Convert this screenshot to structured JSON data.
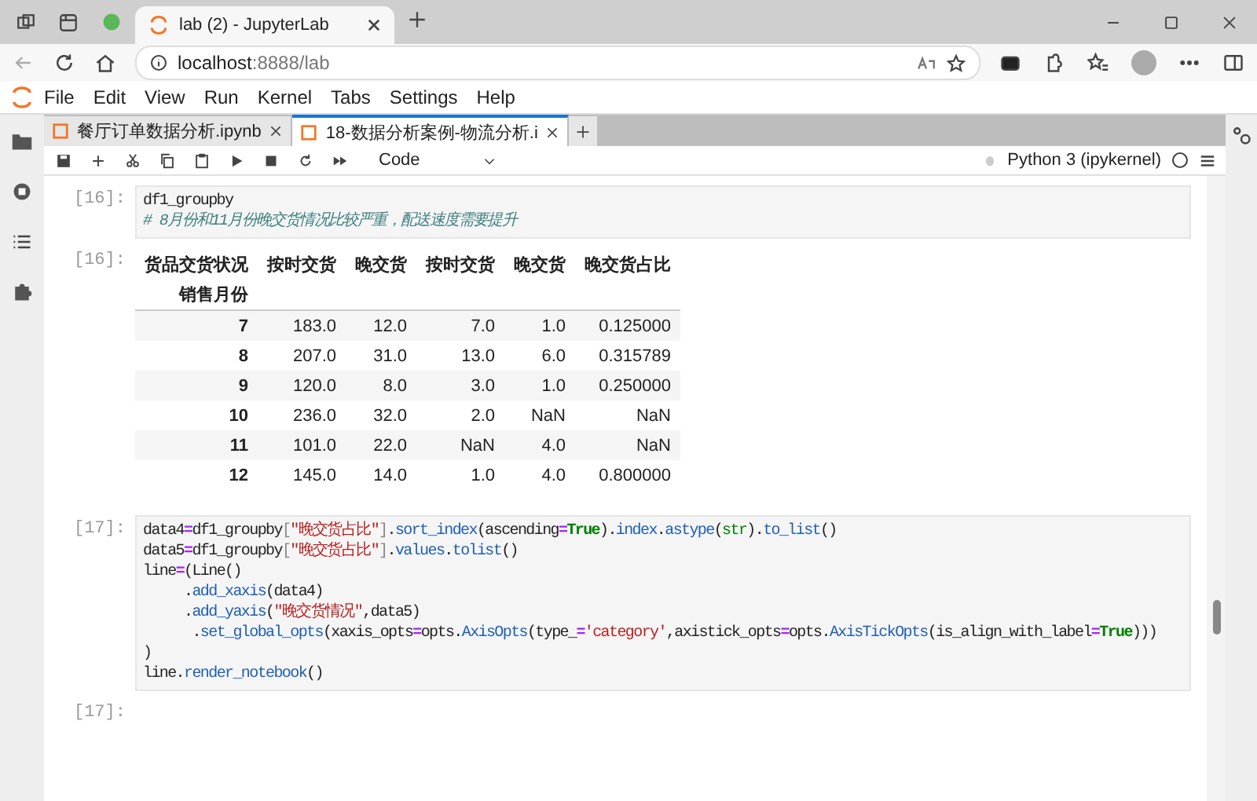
{
  "browser": {
    "tab_title": "lab (2) - JupyterLab",
    "url_host": "localhost",
    "url_rest": ":8888/lab"
  },
  "menu": [
    "File",
    "Edit",
    "View",
    "Run",
    "Kernel",
    "Tabs",
    "Settings",
    "Help"
  ],
  "notebook_tabs": [
    {
      "label": "餐厅订单数据分析.ipynb",
      "selected": false
    },
    {
      "label": "18-数据分析案例-物流分析.i",
      "selected": true
    }
  ],
  "toolbar": {
    "cell_type": "Code",
    "kernel": "Python 3 (ipykernel)"
  },
  "cells": [
    {
      "kind": "code",
      "prompt": "[16]:",
      "lines": [
        [
          {
            "text": "df1_groupby",
            "kind": "plain"
          }
        ],
        [
          {
            "text": "# 8月份和11月份晚交货情况比较严重，配送速度需要提升",
            "kind": "comment"
          }
        ]
      ]
    },
    {
      "kind": "table",
      "prompt": "[16]:",
      "columns": [
        "货品交货状况",
        "按时交货",
        "晚交货",
        "按时交货",
        "晚交货",
        "晚交货占比"
      ],
      "index_name": "销售月份",
      "rows": [
        [
          "7",
          "183.0",
          "12.0",
          "7.0",
          "1.0",
          "0.125000"
        ],
        [
          "8",
          "207.0",
          "31.0",
          "13.0",
          "6.0",
          "0.315789"
        ],
        [
          "9",
          "120.0",
          "8.0",
          "3.0",
          "1.0",
          "0.250000"
        ],
        [
          "10",
          "236.0",
          "32.0",
          "2.0",
          "NaN",
          "NaN"
        ],
        [
          "11",
          "101.0",
          "22.0",
          "NaN",
          "4.0",
          "NaN"
        ],
        [
          "12",
          "145.0",
          "14.0",
          "1.0",
          "4.0",
          "0.800000"
        ]
      ]
    },
    {
      "kind": "code",
      "prompt": "[17]:",
      "lines": [
        [
          {
            "text": "data4",
            "kind": "plain"
          },
          {
            "text": "=",
            "kind": "operator"
          },
          {
            "text": "df1_groupby",
            "kind": "plain"
          },
          {
            "text": "[",
            "kind": "punct"
          },
          {
            "text": "\"晚交货占比\"",
            "kind": "string"
          },
          {
            "text": "]",
            "kind": "punct"
          },
          {
            "text": ".",
            "kind": "plain"
          },
          {
            "text": "sort_index",
            "kind": "function"
          },
          {
            "text": "(ascending",
            "kind": "plain"
          },
          {
            "text": "=",
            "kind": "operator"
          },
          {
            "text": "True",
            "kind": "keyword"
          },
          {
            "text": ").",
            "kind": "plain"
          },
          {
            "text": "index",
            "kind": "function"
          },
          {
            "text": ".",
            "kind": "plain"
          },
          {
            "text": "astype",
            "kind": "function"
          },
          {
            "text": "(",
            "kind": "plain"
          },
          {
            "text": "str",
            "kind": "builtin"
          },
          {
            "text": ").",
            "kind": "plain"
          },
          {
            "text": "to_list",
            "kind": "function"
          },
          {
            "text": "()",
            "kind": "plain"
          }
        ],
        [
          {
            "text": "data5",
            "kind": "plain"
          },
          {
            "text": "=",
            "kind": "operator"
          },
          {
            "text": "df1_groupby",
            "kind": "plain"
          },
          {
            "text": "[",
            "kind": "punct"
          },
          {
            "text": "\"晚交货占比\"",
            "kind": "string"
          },
          {
            "text": "]",
            "kind": "punct"
          },
          {
            "text": ".",
            "kind": "plain"
          },
          {
            "text": "values",
            "kind": "function"
          },
          {
            "text": ".",
            "kind": "plain"
          },
          {
            "text": "tolist",
            "kind": "function"
          },
          {
            "text": "()",
            "kind": "plain"
          }
        ],
        [
          {
            "text": "line",
            "kind": "plain"
          },
          {
            "text": "=",
            "kind": "operator"
          },
          {
            "text": "(Line()",
            "kind": "plain"
          }
        ],
        [
          {
            "text": "     .",
            "kind": "plain"
          },
          {
            "text": "add_xaxis",
            "kind": "function"
          },
          {
            "text": "(data4)",
            "kind": "plain"
          }
        ],
        [
          {
            "text": "     .",
            "kind": "plain"
          },
          {
            "text": "add_yaxis",
            "kind": "function"
          },
          {
            "text": "(",
            "kind": "plain"
          },
          {
            "text": "\"晚交货情况\"",
            "kind": "string"
          },
          {
            "text": ",data5)",
            "kind": "plain"
          }
        ],
        [
          {
            "text": "      .",
            "kind": "plain"
          },
          {
            "text": "set_global_opts",
            "kind": "function"
          },
          {
            "text": "(xaxis_opts",
            "kind": "plain"
          },
          {
            "text": "=",
            "kind": "operator"
          },
          {
            "text": "opts.",
            "kind": "plain"
          },
          {
            "text": "AxisOpts",
            "kind": "function"
          },
          {
            "text": "(type_",
            "kind": "plain"
          },
          {
            "text": "=",
            "kind": "operator"
          },
          {
            "text": "'category'",
            "kind": "string"
          },
          {
            "text": ",axistick_opts",
            "kind": "plain"
          },
          {
            "text": "=",
            "kind": "operator"
          },
          {
            "text": "opts.",
            "kind": "plain"
          },
          {
            "text": "AxisTickOpts",
            "kind": "function"
          },
          {
            "text": "(is_align_with_label",
            "kind": "plain"
          },
          {
            "text": "=",
            "kind": "operator"
          },
          {
            "text": "True",
            "kind": "keyword"
          },
          {
            "text": ")))",
            "kind": "plain"
          }
        ],
        [
          {
            "text": ")",
            "kind": "plain"
          }
        ],
        [
          {
            "text": "line.",
            "kind": "plain"
          },
          {
            "text": "render_notebook",
            "kind": "function"
          },
          {
            "text": "()",
            "kind": "plain"
          }
        ]
      ]
    },
    {
      "kind": "empty",
      "prompt": "[17]:"
    }
  ]
}
